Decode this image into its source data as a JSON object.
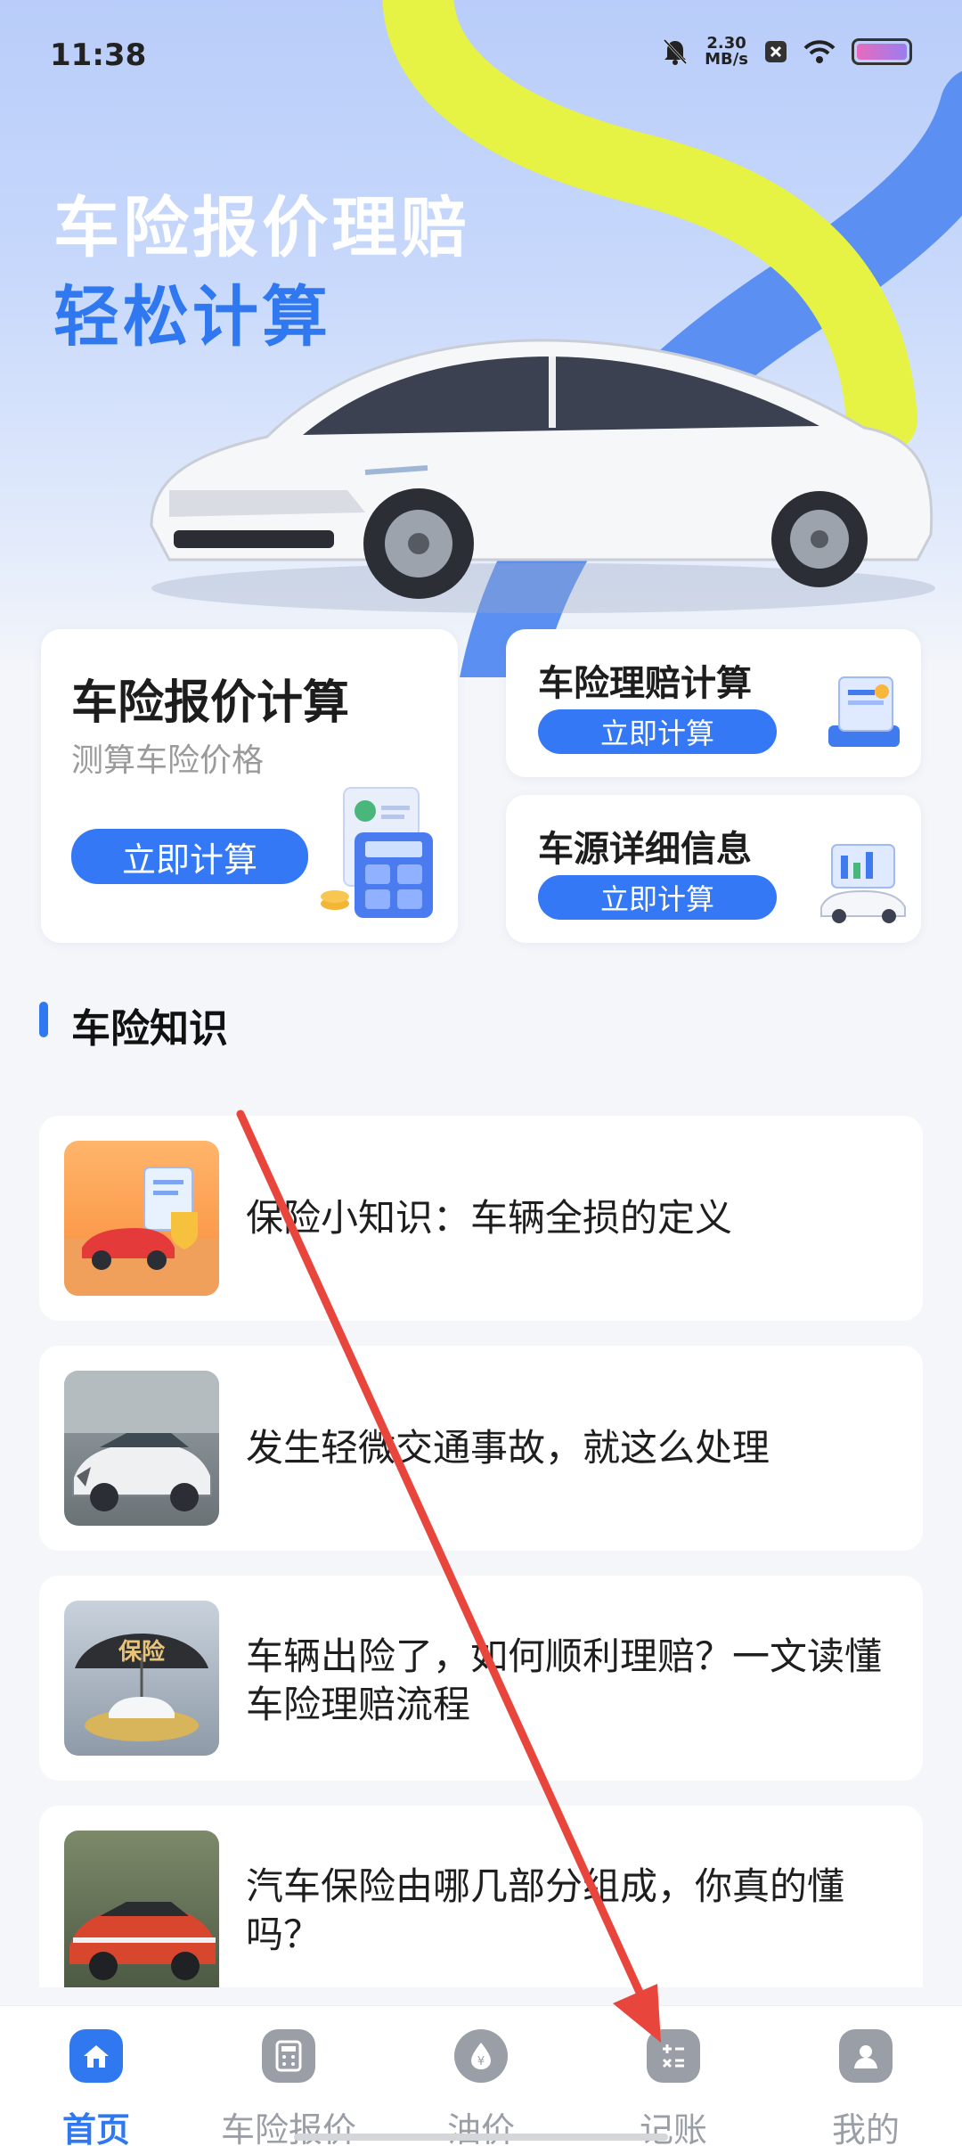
{
  "status_bar": {
    "time": "11:38",
    "speed_value": "2.30",
    "speed_unit": "MB/s",
    "icons": [
      "mute-bell-icon",
      "x-box-icon",
      "wifi-icon",
      "battery-icon"
    ]
  },
  "hero": {
    "title": "车险报价理赔",
    "subtitle": "轻松计算"
  },
  "features": {
    "quote": {
      "title": "车险报价计算",
      "desc": "测算车险价格",
      "button": "立即计算"
    },
    "claim": {
      "title": "车险理赔计算",
      "button": "立即计算"
    },
    "source": {
      "title": "车源详细信息",
      "button": "立即计算"
    }
  },
  "knowledge": {
    "heading": "车险知识",
    "articles": [
      {
        "title": "保险小知识：车辆全损的定义"
      },
      {
        "title": "发生轻微交通事故，就这么处理"
      },
      {
        "title": "车辆出险了，如何顺利理赔？一文读懂车险理赔流程",
        "thumb_text": "保险"
      },
      {
        "title": "汽车保险由哪几部分组成，你真的懂吗？"
      }
    ]
  },
  "nav": {
    "items": [
      {
        "label": "首页",
        "icon": "home-icon",
        "active": true
      },
      {
        "label": "车险报价",
        "icon": "calculator-icon"
      },
      {
        "label": "油价",
        "icon": "oil-drop-icon"
      },
      {
        "label": "记账",
        "icon": "bookkeeping-icon"
      },
      {
        "label": "我的",
        "icon": "user-icon"
      }
    ]
  },
  "colors": {
    "accent": "#2f78f0",
    "button": "#3478f6",
    "annotation_arrow": "#e8453c"
  }
}
